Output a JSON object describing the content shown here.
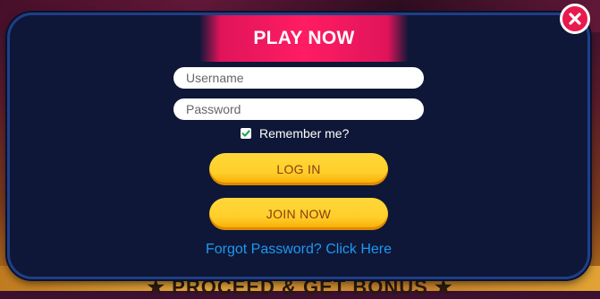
{
  "modal": {
    "title": "PLAY NOW",
    "username": {
      "placeholder": "Username",
      "value": ""
    },
    "password": {
      "placeholder": "Password",
      "value": ""
    },
    "remember": {
      "label": "Remember me?",
      "checked": true
    },
    "buttons": {
      "login": "LOG IN",
      "join": "JOIN NOW"
    },
    "forgot_link": "Forgot Password? Click Here",
    "close_icon": "close-icon"
  },
  "background": {
    "banner_text": "★ PROCEED & GET BONUS ★"
  },
  "colors": {
    "modal_bg": "#0e1737",
    "modal_border": "#1f3f86",
    "header_accent": "#ff1c63",
    "button_yellow": "#ffd73a",
    "button_text": "#8a3b12",
    "link_blue": "#1e98f2",
    "close_red": "#e8194d"
  }
}
